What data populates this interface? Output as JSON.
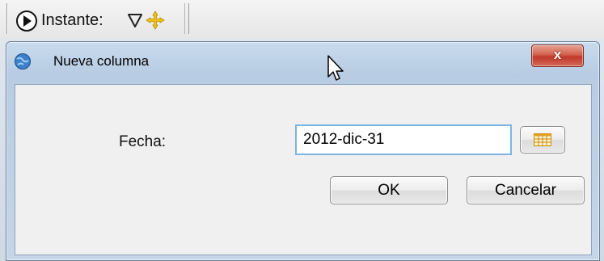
{
  "toolbar": {
    "instante_label": "Instante:",
    "icons": [
      "play-circle-icon",
      "filter-triangle-icon",
      "move-cross-icon"
    ]
  },
  "dialog": {
    "title": "Nueva columna",
    "close_label": "x",
    "fecha_label": "Fecha:",
    "fecha_value": "2012-dic-31",
    "ok_label": "OK",
    "cancel_label": "Cancelar",
    "calendar_icon": "calendar-icon"
  },
  "colors": {
    "close_button": "#c0392b",
    "input_focus_border": "#7fb3e0",
    "dialog_frame": "#b7cce2"
  }
}
